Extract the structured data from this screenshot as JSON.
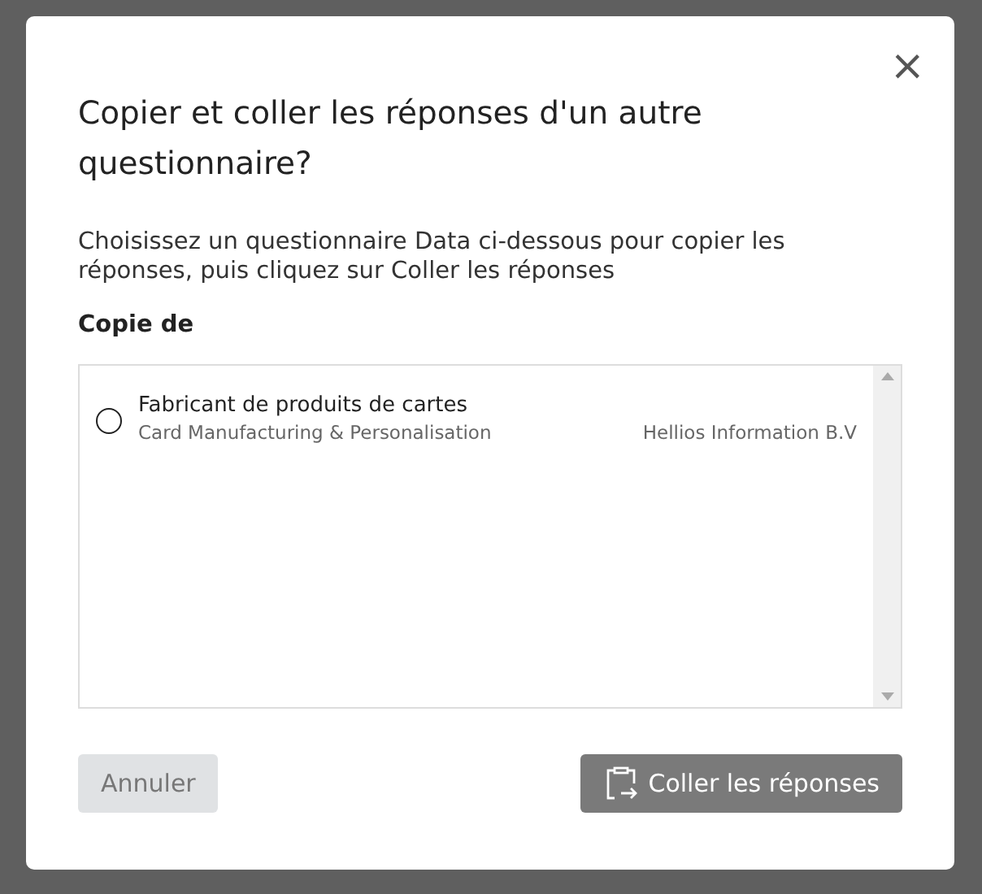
{
  "dialog": {
    "title": "Copier et coller les réponses d'un autre questionnaire?",
    "close": "×",
    "description": "Choisissez un questionnaire Data ci-dessous pour copier les réponses, puis cliquez sur Coller les réponses",
    "list_label": "Copie de",
    "options": [
      {
        "title": "Fabricant de produits de cartes",
        "subtitle": "Card Manufacturing & Personalisation",
        "company": "Hellios Information B.V",
        "selected": false
      }
    ],
    "buttons": [
      {
        "kind": "cancel",
        "label": "Annuler",
        "disabled": true
      },
      {
        "kind": "paste",
        "label": "Coller les réponses",
        "disabled": true
      }
    ]
  }
}
